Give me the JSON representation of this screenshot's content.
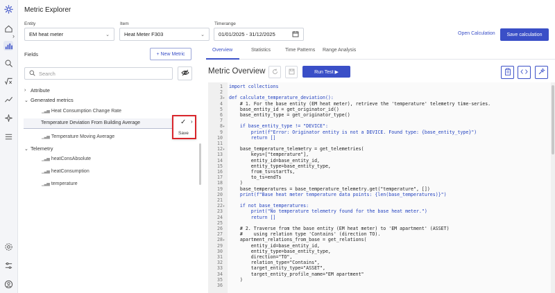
{
  "app": {
    "title": "Metric Explorer"
  },
  "filters": {
    "entity_label": "Entity",
    "entity_value": "EM heat meter",
    "item_label": "Item",
    "item_value": "Heat Meter F303",
    "timerange_label": "Timerange",
    "timerange_value": "01/01/2025 - 31/12/2025"
  },
  "actions": {
    "open_calc": "Open Calculation",
    "save_calc": "Save calculation"
  },
  "left_panel": {
    "fields_label": "Fields",
    "new_metric": "+ New Metric",
    "search_placeholder": "Search",
    "groups": [
      {
        "label": "Attribute"
      },
      {
        "label": "Generated metrics",
        "items": [
          "Heat Consumption Change Rate",
          "Temperature Deviation From Building Average",
          "Temperature Moving Average"
        ]
      },
      {
        "label": "Telemetry",
        "items": [
          "heatConsAbsolute",
          "heatConsumption",
          "temperature"
        ]
      }
    ],
    "editing_value": "Temperature Deviation From Building Average",
    "save_label": "Save"
  },
  "tabs": [
    "Overview",
    "Statistics",
    "Time Patterns",
    "Range Analysis"
  ],
  "overview": {
    "title": "Metric Overview",
    "run_label": "Run Test ▶"
  },
  "code": [
    {
      "n": "1",
      "fold": "",
      "t": "import collections"
    },
    {
      "n": "2",
      "fold": "",
      "t": ""
    },
    {
      "n": "3",
      "fold": "▾",
      "t": "def calculate_temperature_deviation():"
    },
    {
      "n": "4",
      "fold": "",
      "t": "    # 1. For the base entity (EM heat meter), retrieve the 'temperature' telemetry time-series."
    },
    {
      "n": "5",
      "fold": "",
      "t": "    base_entity_id = get_originator_id()"
    },
    {
      "n": "6",
      "fold": "",
      "t": "    base_entity_type = get_originator_type()"
    },
    {
      "n": "7",
      "fold": "",
      "t": ""
    },
    {
      "n": "8",
      "fold": "▾",
      "t": "    if base_entity_type != \"DEVICE\":"
    },
    {
      "n": "9",
      "fold": "",
      "t": "        print(f\"Error: Originator entity is not a DEVICE. Found type: {base_entity_type}\")"
    },
    {
      "n": "10",
      "fold": "",
      "t": "        return []"
    },
    {
      "n": "11",
      "fold": "",
      "t": ""
    },
    {
      "n": "12",
      "fold": "▾",
      "t": "    base_temperature_telemetry = get_telemetries("
    },
    {
      "n": "13",
      "fold": "",
      "t": "        keys=[\"temperature\"],"
    },
    {
      "n": "14",
      "fold": "",
      "t": "        entity_id=base_entity_id,"
    },
    {
      "n": "15",
      "fold": "",
      "t": "        entity_type=base_entity_type,"
    },
    {
      "n": "16",
      "fold": "",
      "t": "        from_ts=startTs,"
    },
    {
      "n": "17",
      "fold": "",
      "t": "        to_ts=endTs"
    },
    {
      "n": "18",
      "fold": "",
      "t": "    )"
    },
    {
      "n": "19",
      "fold": "",
      "t": "    base_temperatures = base_temperature_telemetry.get(\"temperature\", [])"
    },
    {
      "n": "20",
      "fold": "",
      "t": "    print(f\"Base heat meter temperature data points: {len(base_temperatures)}\")"
    },
    {
      "n": "21",
      "fold": "",
      "t": ""
    },
    {
      "n": "22",
      "fold": "▾",
      "t": "    if not base_temperatures:"
    },
    {
      "n": "23",
      "fold": "",
      "t": "        print(\"No temperature telemetry found for the base heat meter.\")"
    },
    {
      "n": "24",
      "fold": "",
      "t": "        return []"
    },
    {
      "n": "25",
      "fold": "",
      "t": ""
    },
    {
      "n": "26",
      "fold": "",
      "t": "    # 2. Traverse from the base entity (EM heat meter) to 'EM apartment' (ASSET)"
    },
    {
      "n": "27",
      "fold": "",
      "t": "    #    using relation type 'Contains' (direction TO)."
    },
    {
      "n": "28",
      "fold": "▾",
      "t": "    apartment_relations_from_base = get_relations("
    },
    {
      "n": "29",
      "fold": "",
      "t": "        entity_id=base_entity_id,"
    },
    {
      "n": "30",
      "fold": "",
      "t": "        entity_type=base_entity_type,"
    },
    {
      "n": "31",
      "fold": "",
      "t": "        direction=\"TO\","
    },
    {
      "n": "32",
      "fold": "",
      "t": "        relation_type=\"Contains\","
    },
    {
      "n": "33",
      "fold": "",
      "t": "        target_entity_type=\"ASSET\","
    },
    {
      "n": "34",
      "fold": "",
      "t": "        target_entity_profile_name=\"EM apartment\""
    },
    {
      "n": "35",
      "fold": "",
      "t": "    )"
    },
    {
      "n": "36",
      "fold": "",
      "t": ""
    }
  ],
  "colors": {
    "accent": "#3a4fc7",
    "highlight": "#d9252b"
  }
}
